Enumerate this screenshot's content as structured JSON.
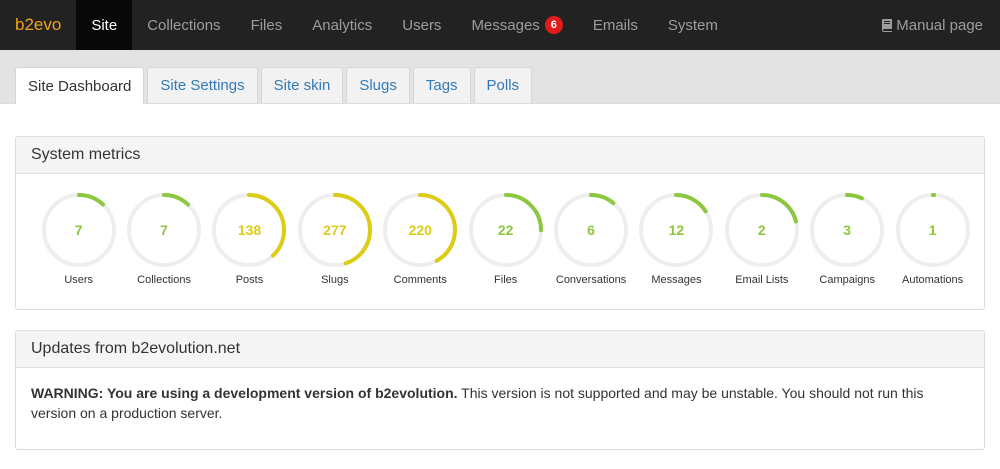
{
  "navbar": {
    "brand": "b2evo",
    "items": [
      {
        "label": "Site",
        "active": true
      },
      {
        "label": "Collections"
      },
      {
        "label": "Files"
      },
      {
        "label": "Analytics"
      },
      {
        "label": "Users"
      },
      {
        "label": "Messages",
        "badge": "6"
      },
      {
        "label": "Emails"
      },
      {
        "label": "System"
      }
    ],
    "manual_page": "Manual page",
    "manual_icon": "book-icon"
  },
  "tabs": [
    {
      "label": "Site Dashboard",
      "active": true
    },
    {
      "label": "Site Settings"
    },
    {
      "label": "Site skin"
    },
    {
      "label": "Slugs"
    },
    {
      "label": "Tags"
    },
    {
      "label": "Polls"
    }
  ],
  "metrics_panel": {
    "title": "System metrics",
    "metrics": [
      {
        "label": "Users",
        "value": "7",
        "fraction": 0.12,
        "color": "#8dc63f"
      },
      {
        "label": "Collections",
        "value": "7",
        "fraction": 0.12,
        "color": "#8dc63f"
      },
      {
        "label": "Posts",
        "value": "138",
        "fraction": 0.38,
        "color": "#dccc15"
      },
      {
        "label": "Slugs",
        "value": "277",
        "fraction": 0.45,
        "color": "#dccc15"
      },
      {
        "label": "Comments",
        "value": "220",
        "fraction": 0.42,
        "color": "#dccc15"
      },
      {
        "label": "Files",
        "value": "22",
        "fraction": 0.25,
        "color": "#8dc63f"
      },
      {
        "label": "Conversations",
        "value": "6",
        "fraction": 0.11,
        "color": "#8dc63f"
      },
      {
        "label": "Messages",
        "value": "12",
        "fraction": 0.16,
        "color": "#8dc63f"
      },
      {
        "label": "Email Lists",
        "value": "2",
        "fraction": 0.21,
        "color": "#8dc63f"
      },
      {
        "label": "Campaigns",
        "value": "3",
        "fraction": 0.07,
        "color": "#8dc63f"
      },
      {
        "label": "Automations",
        "value": "1",
        "fraction": 0.005,
        "color": "#8dc63f"
      }
    ]
  },
  "updates_panel": {
    "title": "Updates from b2evolution.net",
    "warning_bold": "WARNING: You are using a development version of b2evolution.",
    "warning_text": " This version is not supported and may be unstable. You should not run this version on a production server."
  }
}
